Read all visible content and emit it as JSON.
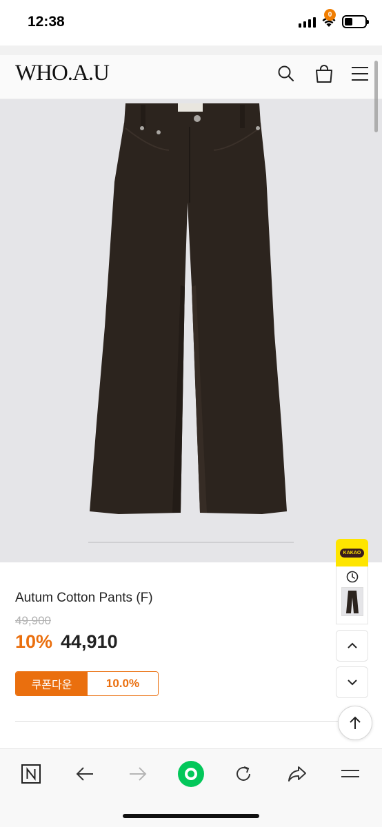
{
  "status_bar": {
    "time": "12:38"
  },
  "header": {
    "logo": "WHO.A.U",
    "cart_count": "0",
    "icons": [
      "search-icon",
      "shopping-bag-icon",
      "hamburger-menu-icon"
    ]
  },
  "product": {
    "name": "Autum Cotton Pants (F)",
    "original_price": "49,900",
    "discount_rate": "10%",
    "sale_price": "44,910",
    "image_color": "#2c241e"
  },
  "coupon": {
    "label": "쿠폰다운",
    "value": "10.0%"
  },
  "side_widgets": {
    "kakao_label": "KAKAO",
    "icons": [
      "clock-icon",
      "chevron-up-icon",
      "chevron-down-icon",
      "arrow-up-icon"
    ]
  },
  "toolbar": {
    "icons": [
      "naver-n-icon",
      "back-arrow-icon",
      "forward-arrow-icon",
      "green-home-icon",
      "reload-icon",
      "share-icon",
      "menu-icon"
    ]
  },
  "colors": {
    "accent": "#ea6f0e",
    "kakao": "#fee500",
    "green": "#03c75a"
  }
}
